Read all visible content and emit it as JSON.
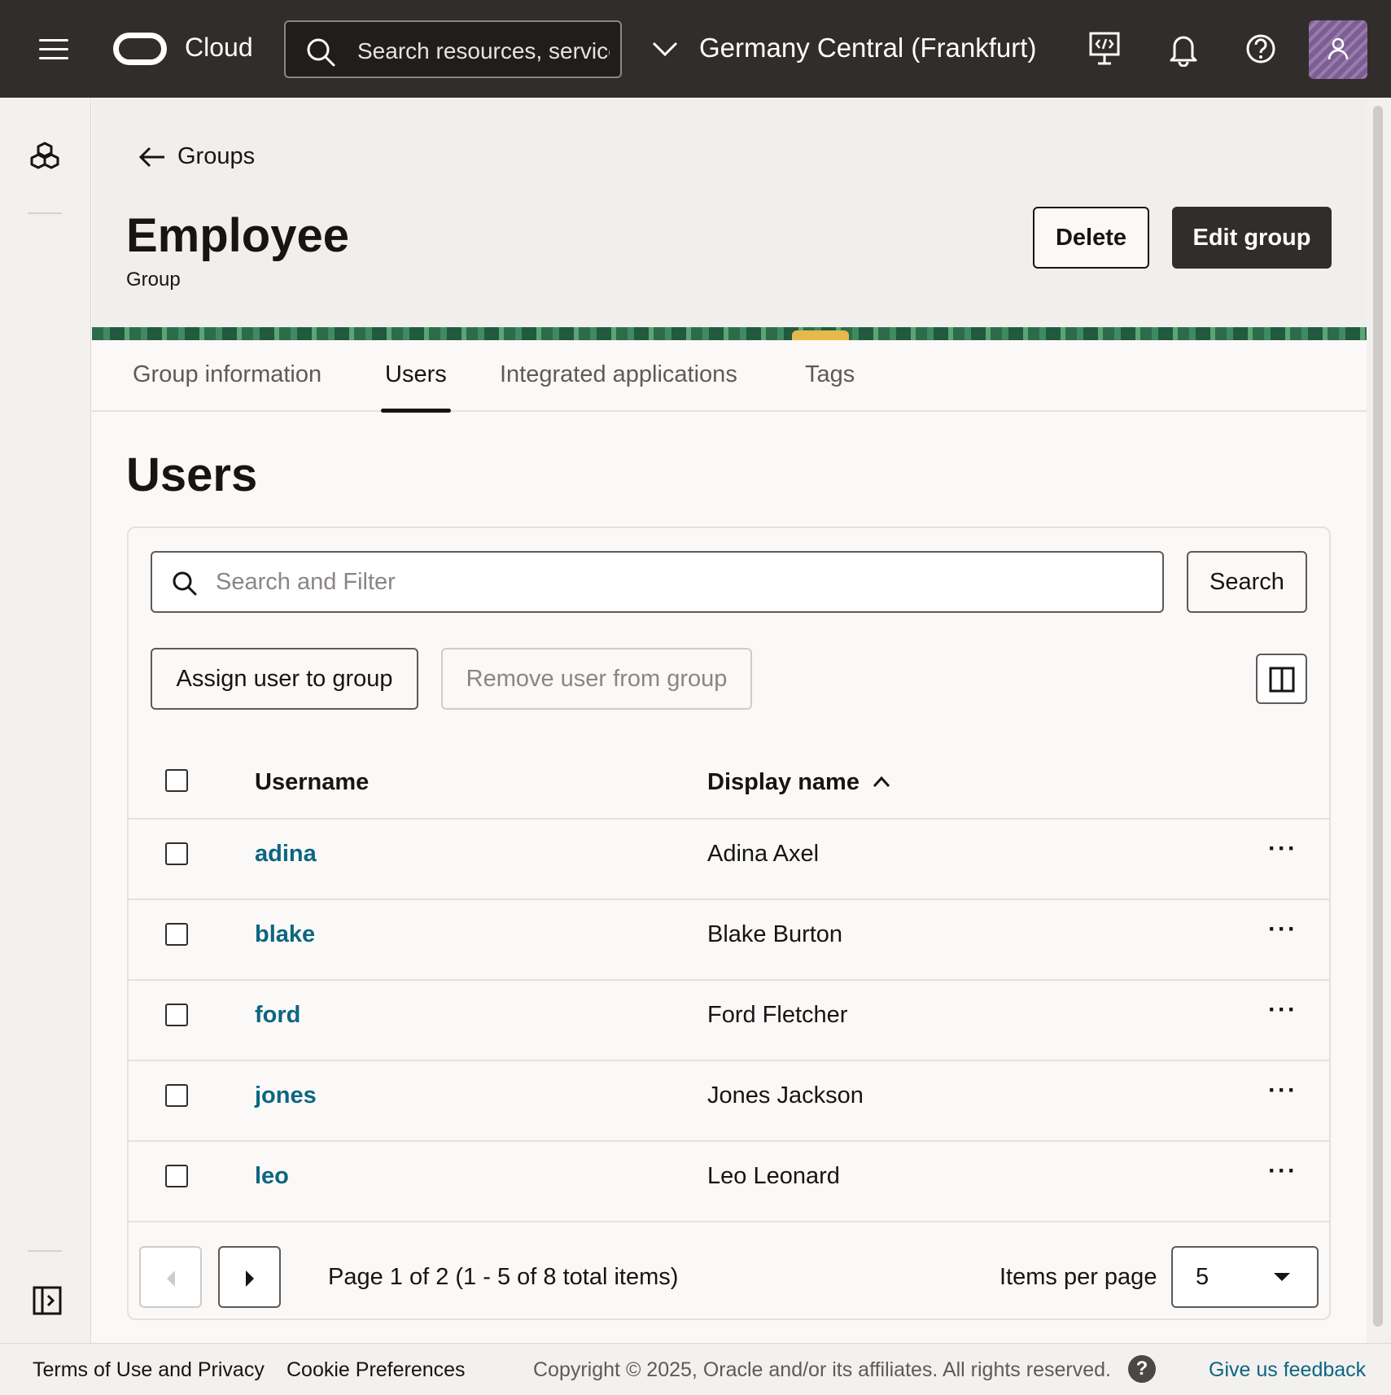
{
  "topbar": {
    "brand": "Cloud",
    "search_placeholder": "Search resources, services",
    "region": "Germany Central (Frankfurt)"
  },
  "icons": {
    "menu": "hamburger-icon",
    "search": "search-icon",
    "region": "chevron-down-icon",
    "cloud_shell": "cloud-shell-icon",
    "notifications": "bell-icon",
    "help": "help-icon",
    "profile": "user-avatar-icon"
  },
  "header": {
    "back_label": "Groups",
    "title": "Employee",
    "subtitle": "Group",
    "delete_label": "Delete",
    "edit_label": "Edit group"
  },
  "tabs": [
    {
      "label": "Group information",
      "active": false
    },
    {
      "label": "Users",
      "active": true
    },
    {
      "label": "Integrated applications",
      "active": false
    },
    {
      "label": "Tags",
      "active": false
    }
  ],
  "users_section": {
    "title": "Users",
    "filter_placeholder": "Search and Filter",
    "search_label": "Search",
    "assign_label": "Assign user to group",
    "remove_label": "Remove user from group",
    "columns": {
      "username": "Username",
      "display_name": "Display name"
    },
    "rows": [
      {
        "username": "adina",
        "display_name": "Adina Axel"
      },
      {
        "username": "blake",
        "display_name": "Blake Burton"
      },
      {
        "username": "ford",
        "display_name": "Ford Fletcher"
      },
      {
        "username": "jones",
        "display_name": "Jones Jackson"
      },
      {
        "username": "leo",
        "display_name": "Leo Leonard"
      }
    ],
    "row_actions": "···",
    "pagination": {
      "info": "Page 1 of 2 (1 - 5 of 8 total items)",
      "items_per_page_label": "Items per page",
      "items_per_page": "5"
    }
  },
  "footer": {
    "terms": "Terms of Use and Privacy",
    "cookies": "Cookie Preferences",
    "copyright": "Copyright © 2025, Oracle and/or its affiliates. All rights reserved.",
    "help": "?",
    "feedback": "Give us feedback"
  }
}
